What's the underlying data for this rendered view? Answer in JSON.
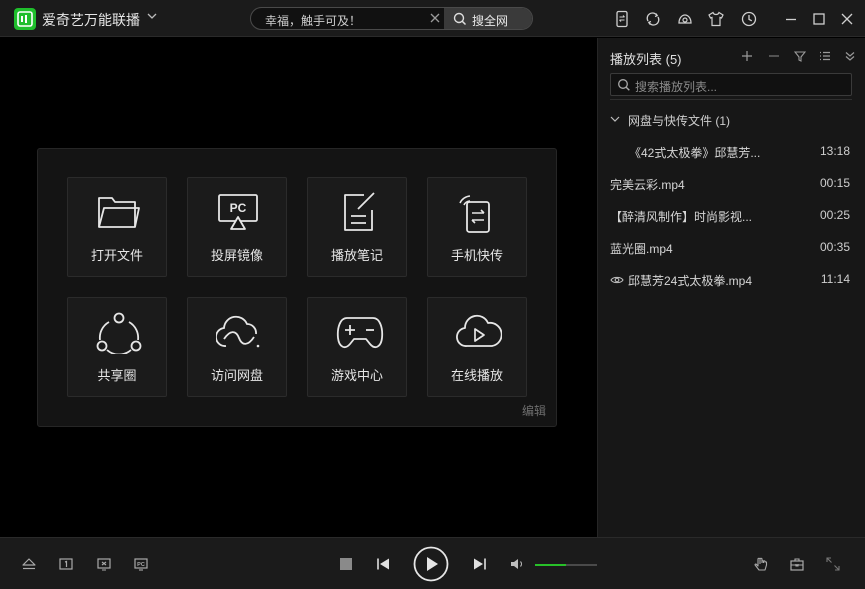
{
  "app": {
    "title": "爱奇艺万能联播",
    "brand_color": "#1fbe2c"
  },
  "search": {
    "value": "幸福，触手可及！",
    "button_label": "搜全网"
  },
  "titlebar_icons": [
    "phone-transfer-icon",
    "sync-icon",
    "skin-icon",
    "shirt-icon",
    "history-icon",
    "minimize-icon",
    "maximize-icon",
    "close-icon"
  ],
  "tiles": [
    {
      "label": "打开文件",
      "icon": "folder-icon"
    },
    {
      "label": "投屏镜像",
      "icon": "pc-cast-icon"
    },
    {
      "label": "播放笔记",
      "icon": "note-icon"
    },
    {
      "label": "手机快传",
      "icon": "phone-transfer-icon"
    },
    {
      "label": "共享圈",
      "icon": "share-icon"
    },
    {
      "label": "访问网盘",
      "icon": "cloud-disk-icon"
    },
    {
      "label": "游戏中心",
      "icon": "gamepad-icon"
    },
    {
      "label": "在线播放",
      "icon": "cloud-play-icon"
    }
  ],
  "panel": {
    "edit_label": "编辑"
  },
  "playlist": {
    "title": "播放列表 (5)",
    "search_placeholder": "搜索播放列表...",
    "group_label": "网盘与快传文件 (1)",
    "items": [
      {
        "name": "《42式太极拳》邱慧芳...",
        "duration": "13:18",
        "indent": true,
        "watched": false
      },
      {
        "name": "完美云彩.mp4",
        "duration": "00:15",
        "indent": false,
        "watched": false
      },
      {
        "name": "【醉清风制作】时尚影视...",
        "duration": "00:25",
        "indent": false,
        "watched": false
      },
      {
        "name": "蓝光圈.mp4",
        "duration": "00:35",
        "indent": false,
        "watched": false
      },
      {
        "name": "邱慧芳24式太极拳.mp4",
        "duration": "11:14",
        "indent": false,
        "watched": true
      }
    ]
  },
  "player": {
    "volume_fraction": 0.5,
    "volume_color": "#28c029"
  }
}
